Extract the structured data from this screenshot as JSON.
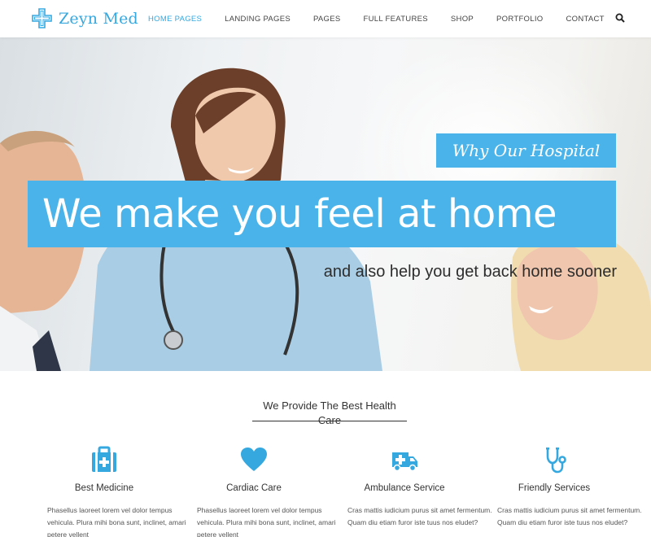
{
  "brand": {
    "name": "Zeyn Med",
    "accent": "#35a8e0"
  },
  "nav": {
    "items": [
      {
        "label": "HOME PAGES",
        "active": true
      },
      {
        "label": "LANDING PAGES",
        "active": false
      },
      {
        "label": "PAGES",
        "active": false
      },
      {
        "label": "FULL FEATURES",
        "active": false
      },
      {
        "label": "SHOP",
        "active": false
      },
      {
        "label": "PORTFOLIO",
        "active": false
      },
      {
        "label": "CONTACT",
        "active": false
      }
    ],
    "search_icon": "search-icon"
  },
  "hero": {
    "tag": "Why Our Hospital",
    "headline": "We make you feel at home",
    "subline": "and also help you get back home sooner",
    "highlight_color": "#4ab4ea"
  },
  "section": {
    "title": "We Provide The Best Health Care"
  },
  "features": [
    {
      "icon": "medical-kit-icon",
      "title": "Best Medicine",
      "text": "Phasellus laoreet lorem vel dolor tempus vehicula. Plura mihi bona sunt, inclinet, amari petere vellent"
    },
    {
      "icon": "heart-icon",
      "title": "Cardiac Care",
      "text": "Phasellus laoreet lorem vel dolor tempus vehicula. Plura mihi bona sunt, inclinet, amari petere vellent"
    },
    {
      "icon": "ambulance-icon",
      "title": "Ambulance Service",
      "text": "Cras mattis iudicium purus sit amet fermentum. Quam diu etiam furor iste tuus nos eludet?"
    },
    {
      "icon": "stethoscope-icon",
      "title": "Friendly Services",
      "text": "Cras mattis iudicium purus sit amet fermentum. Quam diu etiam furor iste tuus nos eludet?"
    }
  ]
}
